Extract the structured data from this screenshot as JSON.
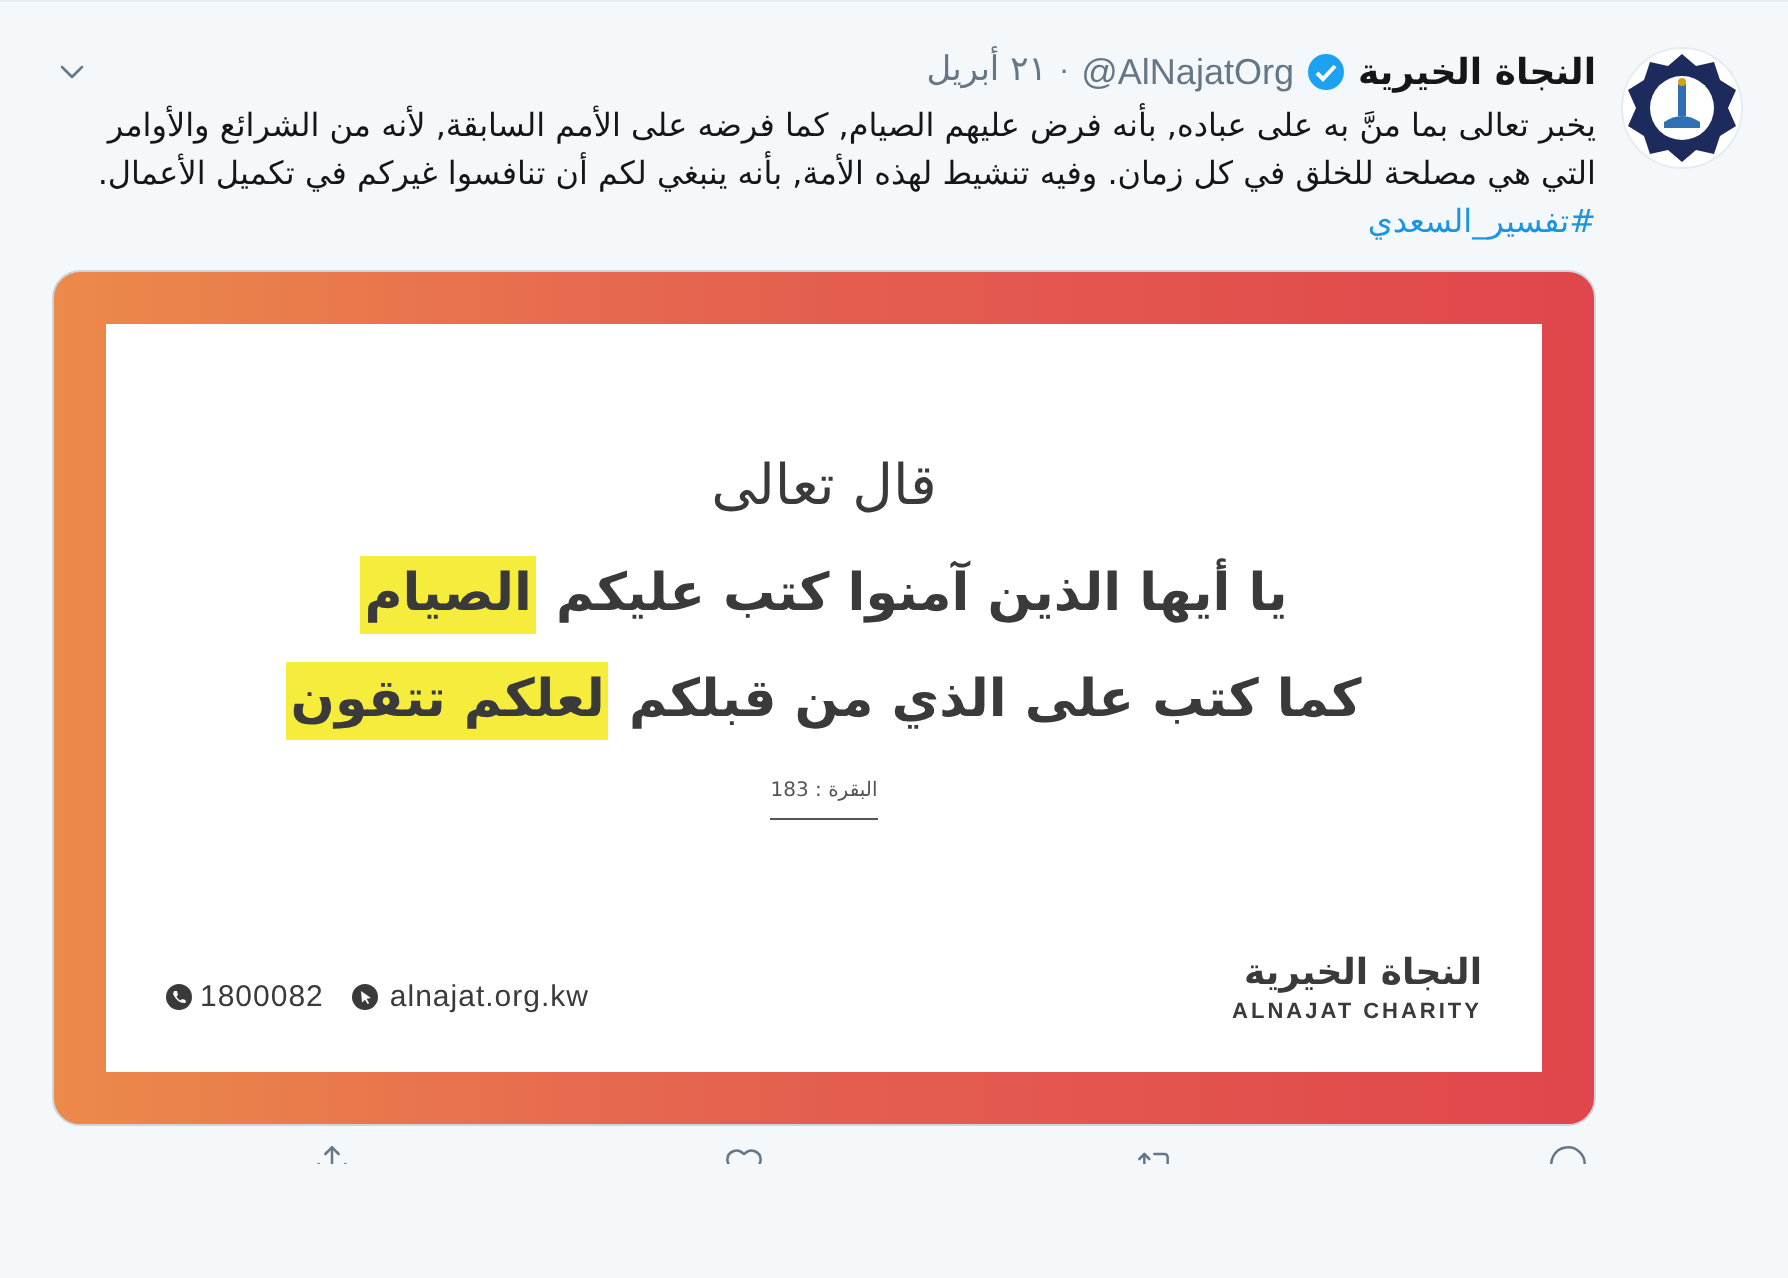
{
  "tweet": {
    "name": "النجاة الخيرية",
    "verified": true,
    "handle": "@AlNajatOrg",
    "separator": "·",
    "date": "٢١ أبريل",
    "text": "يخبر تعالى بما منَّ به على عباده, بأنه فرض عليهم الصيام, كما فرضه على الأمم السابقة, لأنه من الشرائع والأوامر التي هي مصلحة للخلق في كل زمان. وفيه تنشيط لهذه الأمة, بأنه ينبغي لكم أن تنافسوا غيركم في تكميل الأعمال.",
    "hashtag": "#تفسير_السعدي"
  },
  "card": {
    "heading": "قال تعالى",
    "lines": [
      [
        {
          "text": "يا أيها الذين آمنوا كتب عليكم",
          "highlight": false
        },
        {
          "text": "الصيام",
          "highlight": true
        }
      ],
      [
        {
          "text": "كما كتب على الذي من قبلكم",
          "highlight": false
        },
        {
          "text": "لعلكم تتقون",
          "highlight": true
        }
      ]
    ],
    "reference": "البقرة : 183",
    "phone": "1800082",
    "website": "alnajat.org.kw",
    "logo_arabic": "النجاة الخيرية",
    "logo_english": "ALNAJAT CHARITY"
  }
}
